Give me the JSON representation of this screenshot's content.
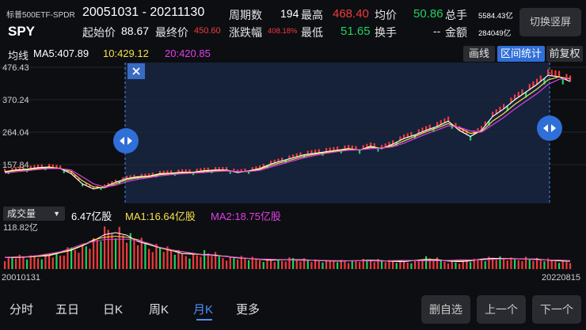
{
  "header": {
    "name": "标普500ETF-SPDR",
    "code": "SPY",
    "range": "20051031 - 20211130",
    "periods_label": "周期数",
    "periods": "194",
    "high_label": "最高",
    "high": "468.40",
    "avg_label": "均价",
    "avg": "50.86",
    "total_hand_label": "总手",
    "total_hand": "5584.43亿",
    "start_label": "起始价",
    "start": "88.67",
    "end_label": "最终价",
    "end": "450.60",
    "change_label": "涨跌幅",
    "change": "408.18%",
    "low_label": "最低",
    "low": "51.65",
    "turnover_label": "换手",
    "turnover": "--",
    "amount_label": "金额",
    "amount": "284049亿",
    "switch_button": "切换竖屏"
  },
  "ma_row": {
    "label": "均线",
    "ma5": "MA5:407.89",
    "ma10": "10:429.12",
    "ma20": "20:420.85",
    "draw_line": "画线",
    "interval_stats": "区间统计",
    "adjust": "前复权"
  },
  "volume_row": {
    "indicator": "成交量",
    "vol": "6.47亿股",
    "ma1": "MA1:16.64亿股",
    "ma2": "MA2:18.75亿股"
  },
  "colors": {
    "up": "#f23b3b",
    "down": "#1fd15e",
    "ma5": "#ffffff",
    "ma10": "#f5e14b",
    "ma20": "#e23ee8",
    "accent": "#4b8ef5"
  },
  "chart_data": {
    "type": "line",
    "title": "",
    "y_ticks": [
      "476.43",
      "370.24",
      "264.04",
      "157.84"
    ],
    "y_min_visible": 51.65,
    "ylim": [
      51.65,
      476.43
    ],
    "x_labels": [
      "20010131",
      "20220815"
    ],
    "series": [
      {
        "name": "MA5",
        "values": [
          135,
          140,
          143,
          148,
          150,
          145,
          128,
          95,
          78,
          85,
          100,
          112,
          118,
          120,
          128,
          130,
          133,
          133,
          138,
          140,
          140,
          132,
          137,
          145,
          160,
          170,
          180,
          190,
          195,
          200,
          205,
          210,
          205,
          218,
          210,
          225,
          243,
          255,
          270,
          283,
          300,
          270,
          250,
          270,
          315,
          340,
          370,
          395,
          420,
          450,
          445,
          430
        ]
      },
      {
        "name": "MA10",
        "values": [
          133,
          138,
          141,
          145,
          148,
          146,
          135,
          105,
          85,
          82,
          95,
          108,
          115,
          118,
          125,
          128,
          131,
          132,
          135,
          138,
          139,
          134,
          136,
          142,
          155,
          165,
          175,
          185,
          192,
          198,
          203,
          208,
          206,
          214,
          212,
          220,
          235,
          250,
          265,
          278,
          292,
          278,
          260,
          265,
          300,
          325,
          355,
          380,
          405,
          435,
          445,
          438
        ]
      },
      {
        "name": "MA20",
        "values": [
          130,
          134,
          138,
          142,
          145,
          145,
          140,
          118,
          95,
          85,
          90,
          102,
          110,
          115,
          121,
          125,
          128,
          130,
          132,
          135,
          137,
          135,
          135,
          139,
          150,
          160,
          170,
          180,
          188,
          195,
          200,
          205,
          206,
          210,
          212,
          216,
          228,
          243,
          258,
          271,
          285,
          280,
          268,
          264,
          288,
          312,
          340,
          365,
          390,
          420,
          437,
          441
        ]
      }
    ],
    "volume": {
      "y_tick": "118.82亿",
      "y_max": 118.82,
      "values": [
        28,
        35,
        30,
        32,
        40,
        36,
        55,
        60,
        72,
        95,
        110,
        88,
        75,
        60,
        62,
        48,
        40,
        36,
        44,
        38,
        30,
        32,
        28,
        26,
        24,
        22,
        28,
        26,
        22,
        20,
        24,
        20,
        22,
        25,
        24,
        20,
        18,
        22,
        30,
        26,
        20,
        18,
        22,
        26,
        32,
        28,
        25,
        30,
        26,
        24,
        22,
        20
      ]
    }
  },
  "nav": {
    "tabs": [
      "分时",
      "五日",
      "日K",
      "周K",
      "月K",
      "更多"
    ],
    "active_index": 4,
    "remove_favorite": "删自选",
    "prev": "上一个",
    "next": "下一个"
  }
}
